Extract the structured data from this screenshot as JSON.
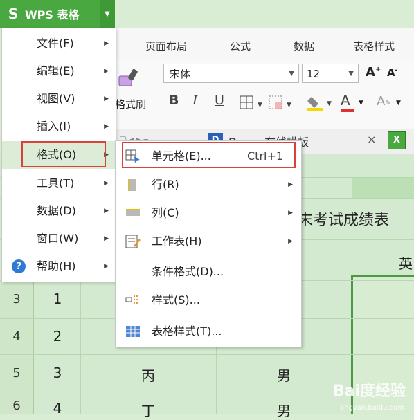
{
  "app": {
    "title": "WPS 表格"
  },
  "ribbon_tabs": [
    "页面布局",
    "公式",
    "数据",
    "表格样式"
  ],
  "ribbon": {
    "format_painter": "格式刷",
    "font_name": "宋体",
    "font_size": "12",
    "bold": "B",
    "italic": "I",
    "underline": "U",
    "font_color": "A"
  },
  "doc_tab": {
    "name": "Docer-在线模板",
    "close": "×"
  },
  "main_menu": [
    {
      "label": "文件(F)",
      "has_sub": true
    },
    {
      "label": "编辑(E)",
      "has_sub": true
    },
    {
      "label": "视图(V)",
      "has_sub": true
    },
    {
      "label": "插入(I)",
      "has_sub": true
    },
    {
      "label": "格式(O)",
      "has_sub": true,
      "active": true
    },
    {
      "label": "工具(T)",
      "has_sub": true
    },
    {
      "label": "数据(D)",
      "has_sub": true
    },
    {
      "label": "窗口(W)",
      "has_sub": true
    },
    {
      "label": "帮助(H)",
      "has_sub": true,
      "icon": "help-icon"
    }
  ],
  "format_submenu": [
    {
      "label": "单元格(E)...",
      "shortcut": "Ctrl+1",
      "icon": "cell-format-icon"
    },
    {
      "label": "行(R)",
      "has_sub": true,
      "icon": "row-icon"
    },
    {
      "label": "列(C)",
      "has_sub": true,
      "icon": "column-icon"
    },
    {
      "label": "工作表(H)",
      "has_sub": true,
      "icon": "worksheet-icon"
    },
    {
      "label": "条件格式(D)..."
    },
    {
      "label": "样式(S)...",
      "icon": "style-icon"
    },
    {
      "label": "表格样式(T)...",
      "icon": "table-style-icon"
    }
  ],
  "sheet": {
    "title_partial": "末考试成绩表",
    "header_partial": "英",
    "rows": [
      {
        "num": "3",
        "id": "1",
        "name": "",
        "gender": ""
      },
      {
        "num": "4",
        "id": "2",
        "name": "",
        "gender": ""
      },
      {
        "num": "5",
        "id": "3",
        "name": "丙",
        "gender": "男"
      },
      {
        "num": "6",
        "id": "4",
        "name": "丁",
        "gender": "男"
      }
    ]
  },
  "watermark": {
    "text": "Bai度经验",
    "sub": "jingyan.baidu.com"
  }
}
